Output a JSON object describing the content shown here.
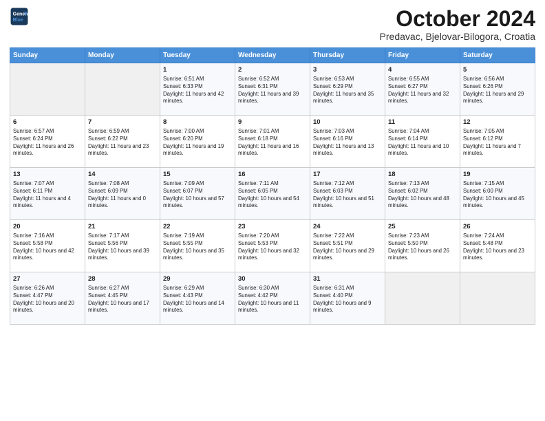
{
  "header": {
    "logo_line1": "General",
    "logo_line2": "Blue",
    "month": "October 2024",
    "location": "Predavac, Bjelovar-Bilogora, Croatia"
  },
  "days_of_week": [
    "Sunday",
    "Monday",
    "Tuesday",
    "Wednesday",
    "Thursday",
    "Friday",
    "Saturday"
  ],
  "weeks": [
    [
      {
        "day": "",
        "detail": ""
      },
      {
        "day": "",
        "detail": ""
      },
      {
        "day": "1",
        "detail": "Sunrise: 6:51 AM\nSunset: 6:33 PM\nDaylight: 11 hours and 42 minutes."
      },
      {
        "day": "2",
        "detail": "Sunrise: 6:52 AM\nSunset: 6:31 PM\nDaylight: 11 hours and 39 minutes."
      },
      {
        "day": "3",
        "detail": "Sunrise: 6:53 AM\nSunset: 6:29 PM\nDaylight: 11 hours and 35 minutes."
      },
      {
        "day": "4",
        "detail": "Sunrise: 6:55 AM\nSunset: 6:27 PM\nDaylight: 11 hours and 32 minutes."
      },
      {
        "day": "5",
        "detail": "Sunrise: 6:56 AM\nSunset: 6:26 PM\nDaylight: 11 hours and 29 minutes."
      }
    ],
    [
      {
        "day": "6",
        "detail": "Sunrise: 6:57 AM\nSunset: 6:24 PM\nDaylight: 11 hours and 26 minutes."
      },
      {
        "day": "7",
        "detail": "Sunrise: 6:59 AM\nSunset: 6:22 PM\nDaylight: 11 hours and 23 minutes."
      },
      {
        "day": "8",
        "detail": "Sunrise: 7:00 AM\nSunset: 6:20 PM\nDaylight: 11 hours and 19 minutes."
      },
      {
        "day": "9",
        "detail": "Sunrise: 7:01 AM\nSunset: 6:18 PM\nDaylight: 11 hours and 16 minutes."
      },
      {
        "day": "10",
        "detail": "Sunrise: 7:03 AM\nSunset: 6:16 PM\nDaylight: 11 hours and 13 minutes."
      },
      {
        "day": "11",
        "detail": "Sunrise: 7:04 AM\nSunset: 6:14 PM\nDaylight: 11 hours and 10 minutes."
      },
      {
        "day": "12",
        "detail": "Sunrise: 7:05 AM\nSunset: 6:12 PM\nDaylight: 11 hours and 7 minutes."
      }
    ],
    [
      {
        "day": "13",
        "detail": "Sunrise: 7:07 AM\nSunset: 6:11 PM\nDaylight: 11 hours and 4 minutes."
      },
      {
        "day": "14",
        "detail": "Sunrise: 7:08 AM\nSunset: 6:09 PM\nDaylight: 11 hours and 0 minutes."
      },
      {
        "day": "15",
        "detail": "Sunrise: 7:09 AM\nSunset: 6:07 PM\nDaylight: 10 hours and 57 minutes."
      },
      {
        "day": "16",
        "detail": "Sunrise: 7:11 AM\nSunset: 6:05 PM\nDaylight: 10 hours and 54 minutes."
      },
      {
        "day": "17",
        "detail": "Sunrise: 7:12 AM\nSunset: 6:03 PM\nDaylight: 10 hours and 51 minutes."
      },
      {
        "day": "18",
        "detail": "Sunrise: 7:13 AM\nSunset: 6:02 PM\nDaylight: 10 hours and 48 minutes."
      },
      {
        "day": "19",
        "detail": "Sunrise: 7:15 AM\nSunset: 6:00 PM\nDaylight: 10 hours and 45 minutes."
      }
    ],
    [
      {
        "day": "20",
        "detail": "Sunrise: 7:16 AM\nSunset: 5:58 PM\nDaylight: 10 hours and 42 minutes."
      },
      {
        "day": "21",
        "detail": "Sunrise: 7:17 AM\nSunset: 5:56 PM\nDaylight: 10 hours and 39 minutes."
      },
      {
        "day": "22",
        "detail": "Sunrise: 7:19 AM\nSunset: 5:55 PM\nDaylight: 10 hours and 35 minutes."
      },
      {
        "day": "23",
        "detail": "Sunrise: 7:20 AM\nSunset: 5:53 PM\nDaylight: 10 hours and 32 minutes."
      },
      {
        "day": "24",
        "detail": "Sunrise: 7:22 AM\nSunset: 5:51 PM\nDaylight: 10 hours and 29 minutes."
      },
      {
        "day": "25",
        "detail": "Sunrise: 7:23 AM\nSunset: 5:50 PM\nDaylight: 10 hours and 26 minutes."
      },
      {
        "day": "26",
        "detail": "Sunrise: 7:24 AM\nSunset: 5:48 PM\nDaylight: 10 hours and 23 minutes."
      }
    ],
    [
      {
        "day": "27",
        "detail": "Sunrise: 6:26 AM\nSunset: 4:47 PM\nDaylight: 10 hours and 20 minutes."
      },
      {
        "day": "28",
        "detail": "Sunrise: 6:27 AM\nSunset: 4:45 PM\nDaylight: 10 hours and 17 minutes."
      },
      {
        "day": "29",
        "detail": "Sunrise: 6:29 AM\nSunset: 4:43 PM\nDaylight: 10 hours and 14 minutes."
      },
      {
        "day": "30",
        "detail": "Sunrise: 6:30 AM\nSunset: 4:42 PM\nDaylight: 10 hours and 11 minutes."
      },
      {
        "day": "31",
        "detail": "Sunrise: 6:31 AM\nSunset: 4:40 PM\nDaylight: 10 hours and 9 minutes."
      },
      {
        "day": "",
        "detail": ""
      },
      {
        "day": "",
        "detail": ""
      }
    ]
  ]
}
